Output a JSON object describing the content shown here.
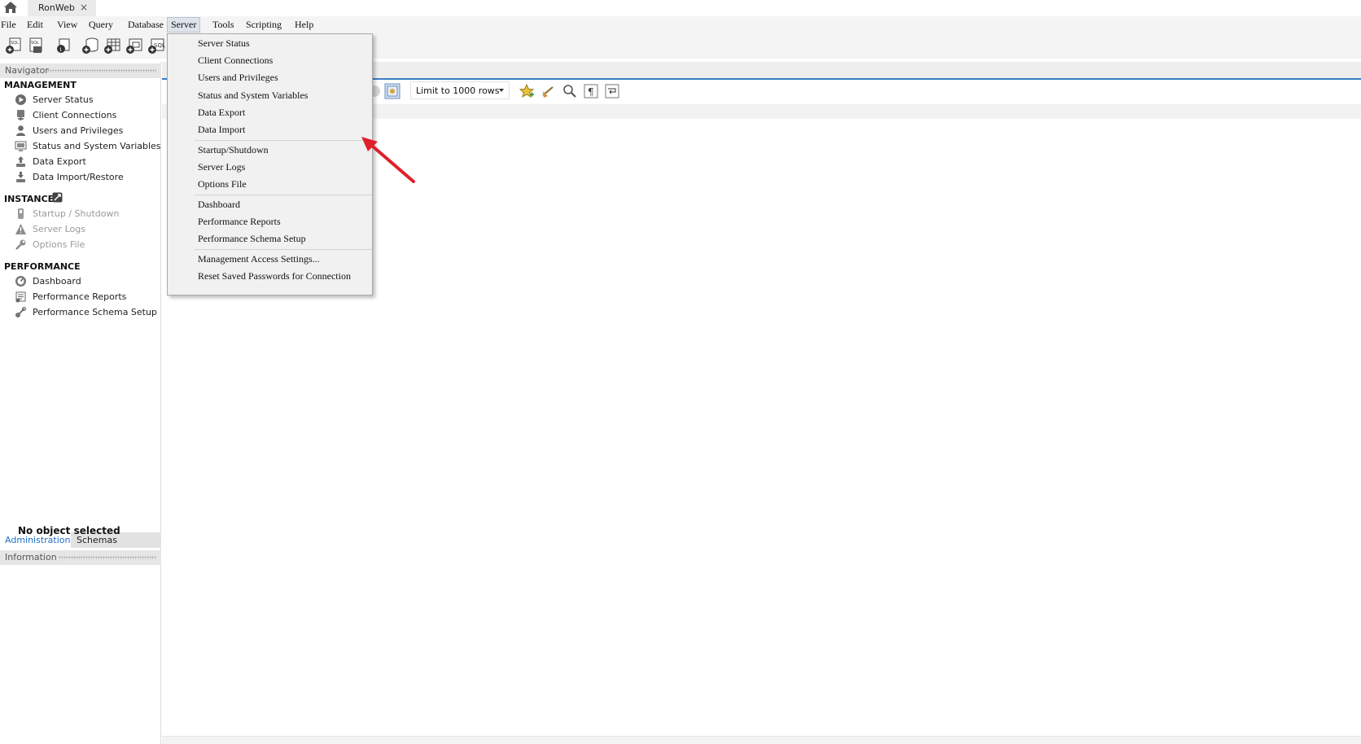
{
  "tabbar": {
    "connection_tab": "RonWeb",
    "close_glyph": "×"
  },
  "menubar": {
    "items": [
      "File",
      "Edit",
      "View",
      "Query",
      "Database",
      "Server",
      "Tools",
      "Scripting",
      "Help"
    ],
    "open_menu": "Server"
  },
  "server_menu": {
    "group1": [
      "Server Status",
      "Client Connections",
      "Users and Privileges",
      "Status and System Variables",
      "Data Export",
      "Data Import"
    ],
    "group2": [
      "Startup/Shutdown",
      "Server Logs",
      "Options File"
    ],
    "group3": [
      "Dashboard",
      "Performance Reports",
      "Performance Schema Setup"
    ],
    "group4": [
      "Management Access Settings...",
      "Reset Saved Passwords for Connection"
    ]
  },
  "navigator": {
    "header": "Navigator",
    "management": {
      "title": "MANAGEMENT",
      "items": [
        "Server Status",
        "Client Connections",
        "Users and Privileges",
        "Status and System Variables",
        "Data Export",
        "Data Import/Restore"
      ]
    },
    "instance": {
      "title": "INSTANCE",
      "items": [
        "Startup / Shutdown",
        "Server Logs",
        "Options File"
      ]
    },
    "performance": {
      "title": "PERFORMANCE",
      "items": [
        "Dashboard",
        "Performance Reports",
        "Performance Schema Setup"
      ]
    },
    "tabs": {
      "administration": "Administration",
      "schemas": "Schemas"
    }
  },
  "information": {
    "header": "Information",
    "empty_text": "No object selected"
  },
  "editor": {
    "limit_rows": "Limit to 1000 rows"
  },
  "colors": {
    "accent": "#3a7fc4",
    "admin_tab_text": "#1f6fc5",
    "annotation_arrow": "#e0202a"
  }
}
